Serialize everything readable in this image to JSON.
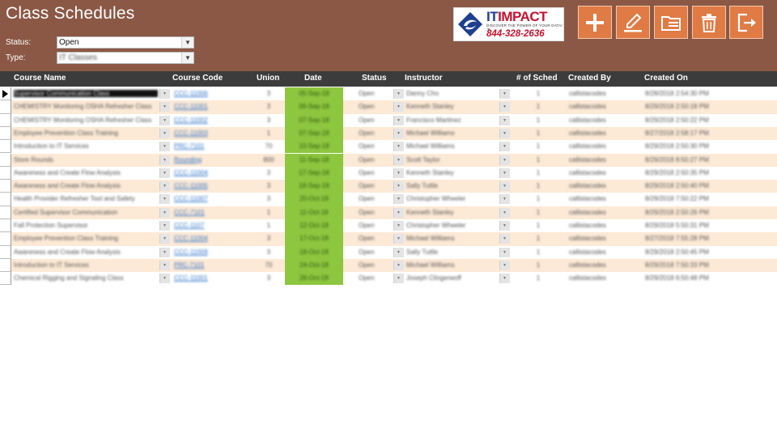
{
  "app": {
    "title": "Class Schedules"
  },
  "filters": {
    "status_label": "Status:",
    "status_value": "Open",
    "type_label": "Type:",
    "type_value": "IT Classes"
  },
  "logo": {
    "name_prefix": "IT",
    "name_suffix": "IMPACT",
    "tagline": "DISCOVER THE POWER OF YOUR DATA!™",
    "phone": "844-328-2636"
  },
  "toolbar": [
    {
      "name": "add-button",
      "icon": "plus-icon"
    },
    {
      "name": "edit-button",
      "icon": "pencil-icon"
    },
    {
      "name": "list-button",
      "icon": "folder-list-icon"
    },
    {
      "name": "delete-button",
      "icon": "trash-icon"
    },
    {
      "name": "exit-button",
      "icon": "exit-icon"
    }
  ],
  "colors": {
    "header": "#8B5845",
    "button": "#E07B45",
    "alt_row": "#FCE9D6",
    "date_cell": "#8DC63F",
    "grid_header": "#3c3c3c"
  },
  "table": {
    "columns": [
      "Course Name",
      "Course Code",
      "Union",
      "Date",
      "Status",
      "Instructor",
      "# of Sched",
      "Created By",
      "Created On"
    ],
    "rows": [
      {
        "course": "Supervisor Communication Class",
        "code": "CCC-11006",
        "union": "3",
        "date": "05-Sep-18",
        "status": "Open",
        "instructor": "Danny Cho",
        "sched": "1",
        "by": "callistacodes",
        "on": "8/28/2018 2:54:30 PM"
      },
      {
        "course": "CHEMISTRY Monitoring OSHA Refresher Class",
        "code": "CCC-11001",
        "union": "3",
        "date": "06-Sep-18",
        "status": "Open",
        "instructor": "Kenneth Stanley",
        "sched": "1",
        "by": "callistacodes",
        "on": "8/29/2018 2:50:18 PM"
      },
      {
        "course": "CHEMISTRY Monitoring OSHA Refresher Class",
        "code": "CCC-11002",
        "union": "3",
        "date": "07-Sep-18",
        "status": "Open",
        "instructor": "Francisco Martinez",
        "sched": "1",
        "by": "callistacodes",
        "on": "8/29/2018 2:50:22 PM"
      },
      {
        "course": "Employee Prevention Class Training",
        "code": "CCC-11003",
        "union": "1",
        "date": "07-Sep-18",
        "status": "Open",
        "instructor": "Michael Williams",
        "sched": "1",
        "by": "callistacodes",
        "on": "8/27/2018 2:58:17 PM"
      },
      {
        "course": "Introduction to IT Services",
        "code": "PRC-7101",
        "union": "70",
        "date": "10-Sep-18",
        "status": "Open",
        "instructor": "Michael Williams",
        "sched": "1",
        "by": "callistacodes",
        "on": "8/29/2018 2:50:30 PM"
      },
      {
        "course": "Store Rounds",
        "code": "Rounding",
        "union": "800",
        "date": "11-Sep-18",
        "status": "Open",
        "instructor": "Scott Taylor",
        "sched": "1",
        "by": "callistacodes",
        "on": "8/29/2018 8:50:27 PM"
      },
      {
        "course": "Awareness and Create Flow Analysis",
        "code": "CCC-11004",
        "union": "3",
        "date": "17-Sep-18",
        "status": "Open",
        "instructor": "Kenneth Stanley",
        "sched": "1",
        "by": "callistacodes",
        "on": "8/29/2018 2:50:35 PM"
      },
      {
        "course": "Awareness and Create Flow Analysis",
        "code": "CCC-11005",
        "union": "3",
        "date": "18-Sep-18",
        "status": "Open",
        "instructor": "Sally Tuttle",
        "sched": "1",
        "by": "callistacodes",
        "on": "8/29/2018 2:50:40 PM"
      },
      {
        "course": "Health Provider Refresher Tool and Safety",
        "code": "CCC-11007",
        "union": "3",
        "date": "20-Oct-18",
        "status": "Open",
        "instructor": "Christopher Wheeler",
        "sched": "1",
        "by": "callistacodes",
        "on": "8/29/2018 7:50:22 PM"
      },
      {
        "course": "Certified Supervisor Communication",
        "code": "CCC-7101",
        "union": "1",
        "date": "11-Oct-18",
        "status": "Open",
        "instructor": "Kenneth Stanley",
        "sched": "1",
        "by": "callistacodes",
        "on": "8/29/2018 2:50:26 PM"
      },
      {
        "course": "Fall Protection Supervisor",
        "code": "CCC-1107",
        "union": "1",
        "date": "12-Oct-18",
        "status": "Open",
        "instructor": "Christopher Wheeler",
        "sched": "1",
        "by": "callistacodes",
        "on": "8/29/2018 5:50:31 PM"
      },
      {
        "course": "Employee Prevention Class Training",
        "code": "CCC-11004",
        "union": "3",
        "date": "17-Oct-18",
        "status": "Open",
        "instructor": "Michael Williams",
        "sched": "1",
        "by": "callistacodes",
        "on": "8/27/2018 7:55:28 PM"
      },
      {
        "course": "Awareness and Create Flow Analysis",
        "code": "CCC-11009",
        "union": "3",
        "date": "18-Oct-18",
        "status": "Open",
        "instructor": "Sally Tuttle",
        "sched": "1",
        "by": "callistacodes",
        "on": "8/29/2018 2:50:45 PM"
      },
      {
        "course": "Introduction to IT Services",
        "code": "PRC-7101",
        "union": "70",
        "date": "24-Oct-18",
        "status": "Open",
        "instructor": "Michael Williams",
        "sched": "1",
        "by": "callistacodes",
        "on": "8/29/2018 7:50:33 PM"
      },
      {
        "course": "Chemical Rigging and Signaling Class",
        "code": "CCC-11001",
        "union": "3",
        "date": "26-Oct-18",
        "status": "Open",
        "instructor": "Joseph Clingerwoff",
        "sched": "1",
        "by": "callistacodes",
        "on": "8/29/2018 6:50:48 PM"
      }
    ]
  }
}
